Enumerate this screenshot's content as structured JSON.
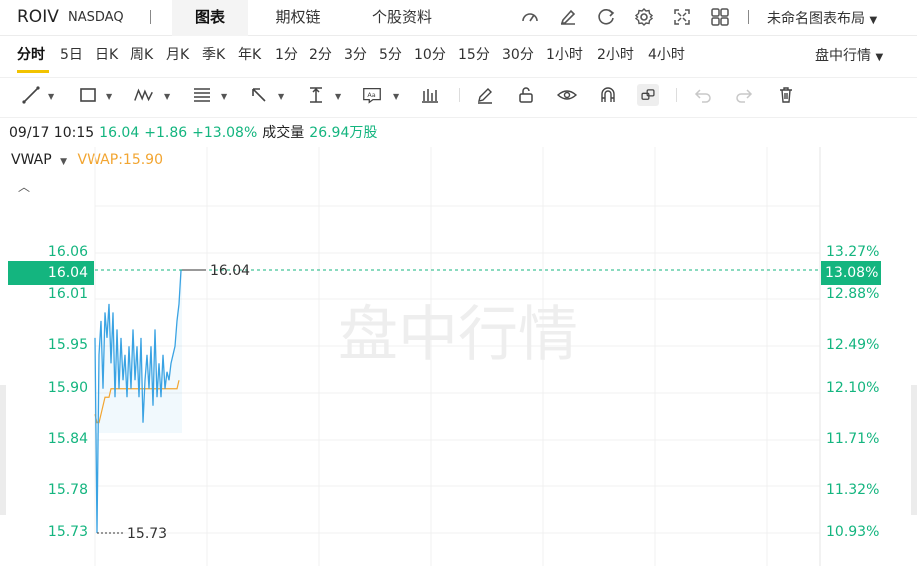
{
  "header": {
    "symbol": "ROIV",
    "exchange": "NASDAQ",
    "tabs": [
      {
        "label": "图表",
        "active": true
      },
      {
        "label": "期权链",
        "active": false
      },
      {
        "label": "个股资料",
        "active": false
      }
    ],
    "icons": [
      "indicator-icon",
      "edit-icon",
      "refresh-icon",
      "settings-icon",
      "fullscreen-icon",
      "grid-layout-icon"
    ],
    "layout_label": "未命名图表布局"
  },
  "timeframes": [
    "分时",
    "5日",
    "日K",
    "周K",
    "月K",
    "季K",
    "年K",
    "1分",
    "2分",
    "3分",
    "5分",
    "10分",
    "15分",
    "30分",
    "1小时",
    "2小时",
    "4小时"
  ],
  "active_timeframe": "分时",
  "session_label": "盘中行情",
  "drawing_tools": [
    "line-tool-icon",
    "rectangle-tool-icon",
    "pattern-tool-icon",
    "fibonacci-tool-icon",
    "arrow-tool-icon",
    "measure-tool-icon",
    "text-tool-icon",
    "indicator-bars-icon",
    "pencil-icon",
    "lock-icon",
    "eye-icon",
    "magnet-icon",
    "link-icon",
    "undo-icon",
    "redo-icon",
    "trash-icon"
  ],
  "info_bar": {
    "datetime": "09/17 10:15",
    "price": "16.04",
    "change": "+1.86",
    "change_pct": "+13.08%",
    "volume_label": "成交量",
    "volume": "26.94万股"
  },
  "vwap": {
    "label": "VWAP",
    "value_text": "VWAP:15.90"
  },
  "colors": {
    "up": "#14b57f",
    "vwap": "#f2a531",
    "price_line": "#3aa3e3",
    "accent": "#f2c300"
  },
  "watermark": "盘中行情",
  "chart_data": {
    "type": "line",
    "y_ticks_left": [
      "16.06",
      "16.01",
      "15.95",
      "15.90",
      "15.84",
      "15.78",
      "15.73"
    ],
    "y_ticks_right": [
      "13.27%",
      "12.88%",
      "12.49%",
      "12.10%",
      "11.71%",
      "11.32%",
      "10.93%"
    ],
    "current_price_label": "16.04",
    "current_pct_label": "13.08%",
    "high_label": "16.04",
    "low_label": "15.73",
    "ylim": [
      15.73,
      16.06
    ],
    "series": [
      {
        "values": [
          15.96,
          15.73,
          15.94,
          15.98,
          15.9,
          15.99,
          15.96,
          16.0,
          15.93,
          15.99,
          15.89,
          15.97,
          15.9,
          15.96,
          15.91,
          15.94,
          15.89,
          15.95,
          15.9,
          15.97,
          15.91,
          15.95,
          15.89,
          15.96,
          15.86,
          15.91,
          15.94,
          15.9,
          15.95,
          15.88,
          15.97,
          15.89,
          15.93,
          15.89,
          15.94,
          15.9,
          15.92,
          15.91,
          15.93,
          15.94,
          15.95,
          15.98,
          16.0,
          16.04,
          16.04
        ]
      },
      {
        "name": "VWAP",
        "values": [
          15.87,
          15.86,
          15.86,
          15.87,
          15.88,
          15.89,
          15.89,
          15.89,
          15.9,
          15.9,
          15.9,
          15.9,
          15.9,
          15.9,
          15.9,
          15.9,
          15.9,
          15.9,
          15.9,
          15.9,
          15.9,
          15.9,
          15.9,
          15.9,
          15.9,
          15.9,
          15.9,
          15.9,
          15.9,
          15.9,
          15.9,
          15.9,
          15.9,
          15.9,
          15.9,
          15.9,
          15.9,
          15.9,
          15.9,
          15.9,
          15.9,
          15.9,
          15.91
        ]
      }
    ]
  }
}
